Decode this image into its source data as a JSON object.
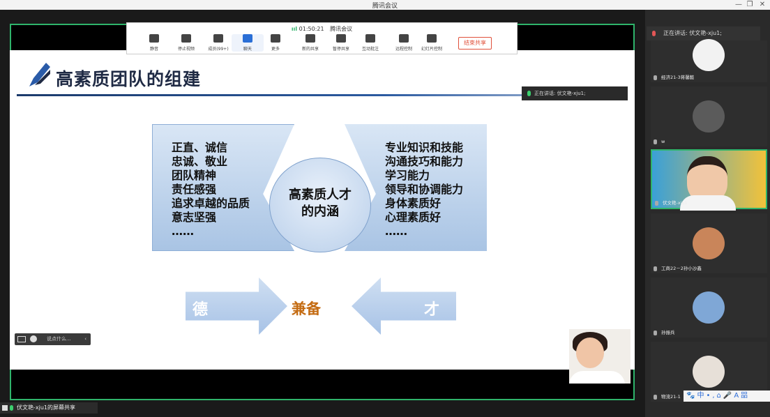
{
  "window": {
    "title": "腾讯会议",
    "min": "—",
    "max": "❐",
    "close": "✕"
  },
  "toolbar": {
    "timer": "01:50:21",
    "timer_label": "腾讯会议",
    "items": [
      {
        "label": "静音"
      },
      {
        "label": "停止视频"
      },
      {
        "label": "成员(99+)"
      },
      {
        "label": "聊天"
      },
      {
        "label": "更多"
      },
      {
        "label": "新的共享"
      },
      {
        "label": "暂停共享"
      },
      {
        "label": "互动批注"
      },
      {
        "label": "远程控制"
      },
      {
        "label": "幻灯片控制"
      }
    ],
    "end_share": "结束共享"
  },
  "slide": {
    "title": "高素质团队的组建",
    "left_list": [
      "正直、诚信",
      "忠诚、敬业",
      "团队精神",
      "责任感强",
      "追求卓越的品质",
      "意志坚强",
      "……"
    ],
    "center_text": [
      "高素质人才",
      "的内涵"
    ],
    "right_list": [
      "专业知识和技能",
      "沟通技巧和能力",
      "学习能力",
      "领导和协调能力",
      "身体素质好",
      "心理素质好",
      "……"
    ],
    "arrow_left": "德",
    "arrow_right": "才",
    "center_word": "兼备"
  },
  "overlay_speaking": "正在讲话: 伏文艳-xju1;",
  "minibar": {
    "placeholder": "说点什么...",
    "collapse": "‹"
  },
  "share_status": "伏文艳-xju1的屏幕共享",
  "right_panel": {
    "speaking": "正在讲话: 伏文艳-xju1;",
    "participants": [
      {
        "name": "经济21-3蒋馨懿",
        "color": "#f2f2f2"
      },
      {
        "name": "w",
        "color": "#5b5b5b"
      },
      {
        "name": "伏文艳-xju1",
        "color": "#f2c23a"
      },
      {
        "name": "工商22－2孙小沙鑫",
        "color": "#c9855a"
      },
      {
        "name": "孙振兵",
        "color": "#7fa7d6"
      },
      {
        "name": "物流21-1",
        "color": "#e7e0d8"
      }
    ],
    "ime": "🐾中•,⌂🎤A㗊"
  }
}
